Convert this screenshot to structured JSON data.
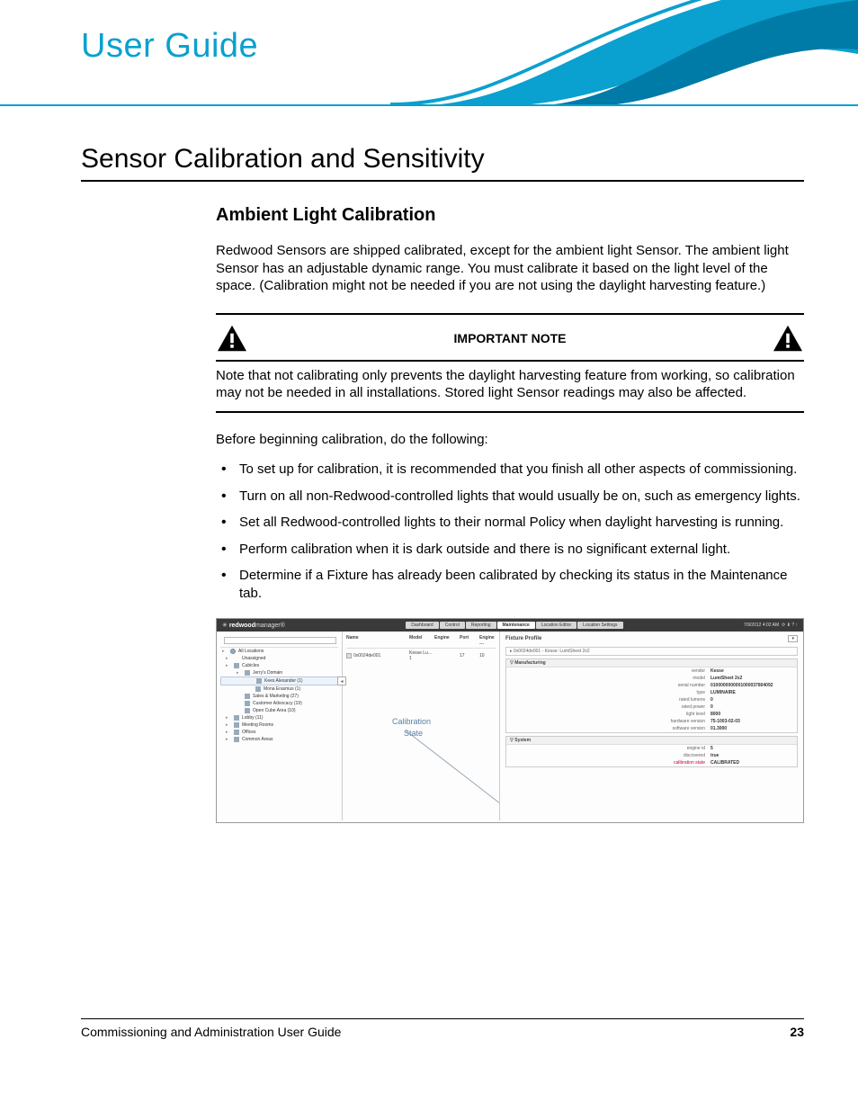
{
  "header": {
    "title": "User Guide"
  },
  "h1": "Sensor Calibration and Sensitivity",
  "h2": "Ambient Light Calibration",
  "intro": "Redwood Sensors are shipped calibrated, except for the ambient light Sensor. The ambient light Sensor has an adjustable dynamic range. You must calibrate it based on the light level of the space. (Calibration might not be needed if you are not using the daylight harvesting feature.)",
  "note": {
    "title": "IMPORTANT NOTE",
    "body": "Note that not calibrating only prevents the daylight harvesting feature from working, so calibration may not be needed in all installations. Stored light Sensor readings may also be affected."
  },
  "before": "Before beginning calibration, do the following:",
  "bullets": [
    "To set up for calibration, it is recommended that you finish all other aspects of commissioning.",
    "Turn on all non-Redwood-controlled lights that would usually be on, such as emergency lights.",
    "Set all Redwood-controlled lights to their normal Policy when daylight harvesting is running.",
    "Perform calibration when it is dark outside and there is no significant external light.",
    "Determine if a Fixture has already been calibrated by checking its status in the Maintenance tab."
  ],
  "screenshot": {
    "brand_a": "redwood",
    "brand_b": "manager",
    "tabs": [
      "Dashboard",
      "Control",
      "Reporting",
      "Maintenance",
      "Location Editor",
      "Location Settings"
    ],
    "active_tab": 3,
    "timestamp": "7/9/2012 4:02 AM",
    "tree": [
      {
        "lvl": 0,
        "ic": "round",
        "label": "All Locations"
      },
      {
        "lvl": 1,
        "ic": "none",
        "label": "Unassigned"
      },
      {
        "lvl": 1,
        "ic": "sq",
        "label": "Cubicles"
      },
      {
        "lvl": 2,
        "ic": "sq",
        "label": "Jerry's Domain",
        "exp": true
      },
      {
        "lvl": 3,
        "ic": "sq",
        "label": "Kees Alexander (1)",
        "sel": true
      },
      {
        "lvl": 3,
        "ic": "sq",
        "label": "Mona Erasmus (1)"
      },
      {
        "lvl": 2,
        "ic": "sq",
        "label": "Sales & Marketing (27)"
      },
      {
        "lvl": 2,
        "ic": "sq",
        "label": "Customer Advocacy (19)"
      },
      {
        "lvl": 2,
        "ic": "sq",
        "label": "Open Cube Area (10)"
      },
      {
        "lvl": 1,
        "ic": "sq",
        "label": "Lobby (11)"
      },
      {
        "lvl": 1,
        "ic": "sq",
        "label": "Meeting Rooms"
      },
      {
        "lvl": 1,
        "ic": "sq",
        "label": "Offices"
      },
      {
        "lvl": 1,
        "ic": "sq",
        "label": "Common Areas"
      }
    ],
    "mid": {
      "cols": [
        "Name",
        "Model",
        "Engine",
        "Port",
        "Engine …"
      ],
      "row": {
        "name": "0x0024de001",
        "model": "Kesse Lu… 1",
        "engine": "",
        "port": "17",
        "engine2": "10"
      }
    },
    "annotation1": "Calibration",
    "annotation2": "State",
    "right": {
      "title": "Fixture Profile",
      "crumb": "0x0024de001 - Kesse: LumiSheet 2x2",
      "sec1": "Manufacturing",
      "rows1": [
        {
          "k": "vendor",
          "v": "Kesse"
        },
        {
          "k": "model",
          "v": "LumiSheet 2x2"
        },
        {
          "k": "serial number",
          "v": "0100000000001000037804092"
        },
        {
          "k": "type",
          "v": "LUMINAIRE"
        },
        {
          "k": "rated lumens",
          "v": "0"
        },
        {
          "k": "rated power",
          "v": "0"
        },
        {
          "k": "light level",
          "v": "8000"
        },
        {
          "k": "hardware version",
          "v": "75-1003-02-03"
        },
        {
          "k": "software version",
          "v": "01.3000"
        }
      ],
      "sec2": "System",
      "rows2": [
        {
          "k": "engine id",
          "v": "5"
        },
        {
          "k": "discovered",
          "v": "true"
        },
        {
          "k": "calibration state",
          "v": "CALIBRATED",
          "hl": true
        }
      ]
    }
  },
  "footer": {
    "left": "Commissioning and Administration User Guide",
    "page": "23"
  }
}
